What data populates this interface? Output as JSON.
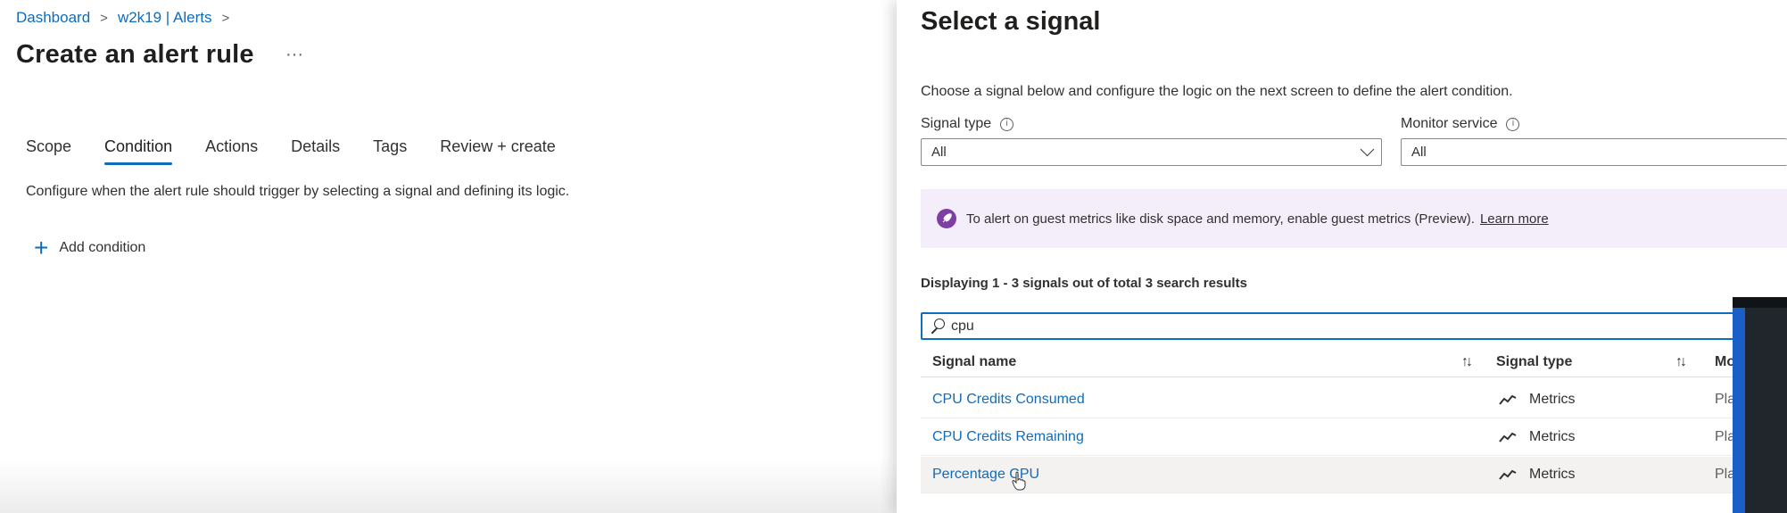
{
  "breadcrumb": {
    "items": [
      "Dashboard",
      "w2k19 | Alerts"
    ],
    "separator": ">"
  },
  "page": {
    "title": "Create an alert rule",
    "more": "···"
  },
  "tabs": [
    "Scope",
    "Condition",
    "Actions",
    "Details",
    "Tags",
    "Review + create"
  ],
  "active_tab": "Condition",
  "description": "Configure when the alert rule should trigger by selecting a signal and defining its logic.",
  "add_condition": {
    "icon": "+",
    "label": "Add condition"
  },
  "panel": {
    "title": "Select a signal",
    "description": "Choose a signal below and configure the logic on the next screen to define the alert condition.",
    "signal_type": {
      "label": "Signal type",
      "value": "All",
      "info": "i"
    },
    "monitor_service": {
      "label": "Monitor service",
      "value": "All",
      "info": "i"
    },
    "banner": {
      "text": "To alert on guest metrics like disk space and memory, enable guest metrics (Preview).",
      "link": "Learn more"
    },
    "result_count": "Displaying 1 - 3 signals out of total 3 search results",
    "search": {
      "value": "cpu"
    },
    "table": {
      "columns": [
        "Signal name",
        "Signal type",
        "Mo"
      ],
      "sort_icon": "↑↓",
      "rows": [
        {
          "name": "CPU Credits Consumed",
          "type": "Metrics",
          "monitor": "Plat"
        },
        {
          "name": "CPU Credits Remaining",
          "type": "Metrics",
          "monitor": "Plat"
        },
        {
          "name": "Percentage CPU",
          "type": "Metrics",
          "monitor": "Plat"
        }
      ]
    }
  },
  "colors": {
    "accent": "#0f6cbd",
    "banner_bg": "#f4eefa",
    "banner_icon": "#7e3fa5",
    "text": "#323130"
  }
}
